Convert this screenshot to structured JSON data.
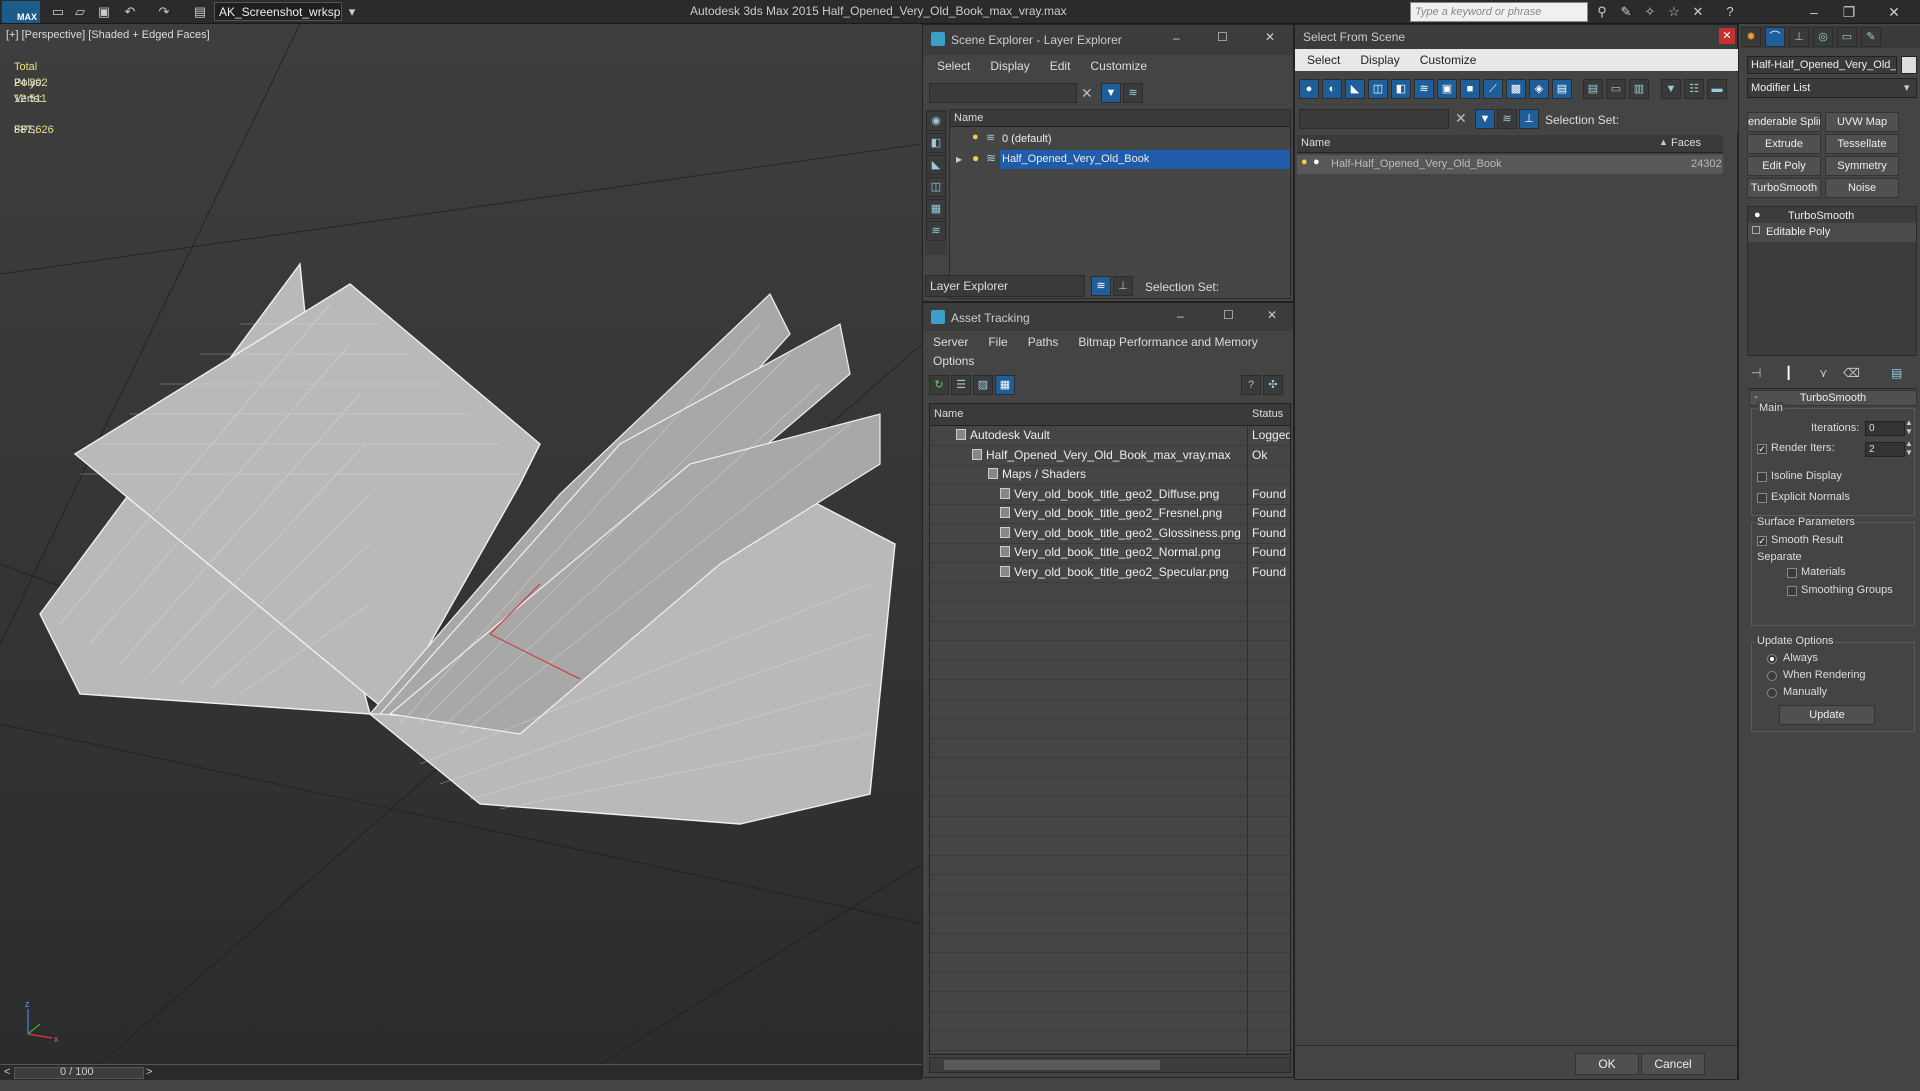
{
  "app": {
    "logo_text": "MAX",
    "workspace": "AK_Screenshot_wrksp",
    "title": "Autodesk 3ds Max  2015     Half_Opened_Very_Old_Book_max_vray.max",
    "search_placeholder": "Type a keyword or phrase"
  },
  "viewport": {
    "label": "[+] [Perspective] [Shaded + Edged Faces]",
    "stats": {
      "total_label": "Total",
      "polys_label": "Polys:",
      "polys_value": "24 302",
      "verts_label": "Verts:",
      "verts_value": "12 511",
      "fps_label": "FPS:",
      "fps_value": "887,626"
    },
    "axis_z": "z",
    "axis_x": "x"
  },
  "timeline": {
    "frame": "0 / 100",
    "prev": "<",
    "next": ">"
  },
  "scene_explorer": {
    "title": "Scene Explorer - Layer Explorer",
    "menu": [
      "Select",
      "Display",
      "Edit",
      "Customize"
    ],
    "column_name": "Name",
    "rows": [
      "0 (default)",
      "Half_Opened_Very_Old_Book"
    ],
    "footer_dropdown": "Layer Explorer",
    "selection_set_label": "Selection Set:"
  },
  "asset_tracking": {
    "title": "Asset Tracking",
    "menu": [
      "Server",
      "File",
      "Paths",
      "Bitmap Performance and Memory"
    ],
    "menu2": "Options",
    "col_name": "Name",
    "col_status": "Status",
    "rows": [
      {
        "name": "Autodesk Vault",
        "status": "Logged"
      },
      {
        "name": "Half_Opened_Very_Old_Book_max_vray.max",
        "status": "Ok"
      },
      {
        "name": "Maps / Shaders",
        "status": ""
      },
      {
        "name": "Very_old_book_title_geo2_Diffuse.png",
        "status": "Found"
      },
      {
        "name": "Very_old_book_title_geo2_Fresnel.png",
        "status": "Found"
      },
      {
        "name": "Very_old_book_title_geo2_Glossiness.png",
        "status": "Found"
      },
      {
        "name": "Very_old_book_title_geo2_Normal.png",
        "status": "Found"
      },
      {
        "name": "Very_old_book_title_geo2_Specular.png",
        "status": "Found"
      }
    ]
  },
  "select_from_scene": {
    "title": "Select From Scene",
    "menu": [
      "Select",
      "Display",
      "Customize"
    ],
    "selection_set_label": "Selection Set:",
    "col_name": "Name",
    "col_faces": "Faces",
    "rows": [
      {
        "name": "Half-Half_Opened_Very_Old_Book",
        "faces": "24302"
      }
    ],
    "ok": "OK",
    "cancel": "Cancel"
  },
  "command_panel": {
    "object_name": "Half-Half_Opened_Very_Old_",
    "modifier_list": "Modifier List",
    "buttons": [
      "enderable Splir",
      "UVW Map",
      "Extrude",
      "Tessellate",
      "Edit Poly",
      "Symmetry",
      "TurboSmooth",
      "Noise"
    ],
    "stack": [
      "TurboSmooth",
      "Editable Poly"
    ],
    "rollout_title": "TurboSmooth",
    "main_label": "Main",
    "iterations_label": "Iterations:",
    "iterations_value": "0",
    "render_iters_label": "Render Iters:",
    "render_iters_value": "2",
    "isoline": "Isoline Display",
    "explicit_normals": "Explicit Normals",
    "surface_params": "Surface Parameters",
    "smooth_result": "Smooth Result",
    "separate": "Separate",
    "materials": "Materials",
    "smoothing_groups": "Smoothing Groups",
    "update_options": "Update Options",
    "always": "Always",
    "when_rendering": "When Rendering",
    "manually": "Manually",
    "update": "Update"
  }
}
